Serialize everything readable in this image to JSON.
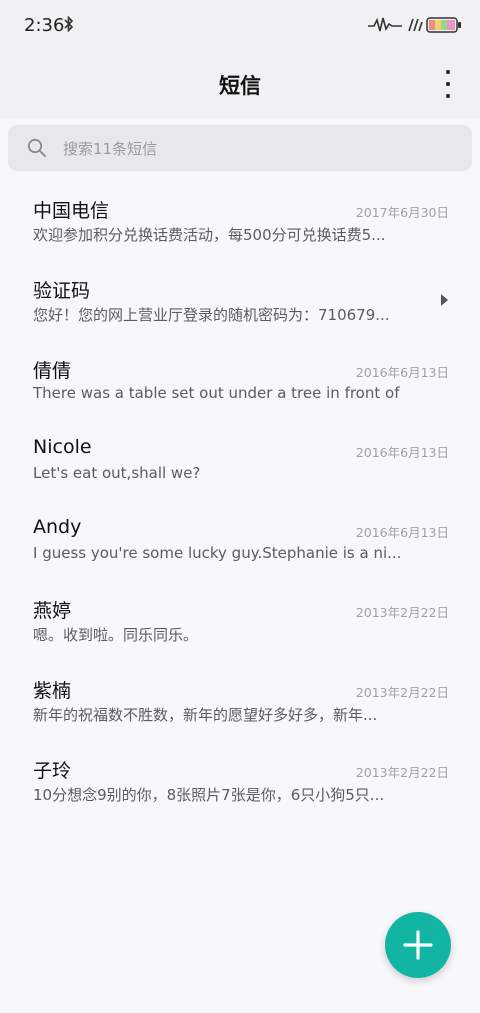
{
  "status_bar": {
    "time": "2:36",
    "icons": [
      "bluetooth-icon",
      "signal-icon",
      "wifi-icon",
      "battery-icon"
    ]
  },
  "header": {
    "title": "短信",
    "menu_icon": "more-vertical-icon"
  },
  "search": {
    "placeholder": "搜索11条短信",
    "icon": "search-icon"
  },
  "messages": [
    {
      "name": "中国电信",
      "date": "2017年6月30日",
      "preview": "欢迎参加积分兑换话费活动，每500分可兑换话费5..."
    },
    {
      "name": "验证码",
      "date": "",
      "preview": "您好！您的网上营业厅登录的随机密码为：710679...",
      "icon": "expand-arrow-icon"
    },
    {
      "name": "倩倩",
      "date": "2016年6月13日",
      "preview": "There was a table set out under a tree in front of ..."
    },
    {
      "name": "Nicole",
      "date": "2016年6月13日",
      "preview": "Let's eat out,shall we?"
    },
    {
      "name": "Andy",
      "date": "2016年6月13日",
      "preview": "I guess you're some lucky guy.Stephanie is a ni..."
    },
    {
      "name": "燕婷",
      "date": "2013年2月22日",
      "preview": "嗯。收到啦。同乐同乐。"
    },
    {
      "name": "紫楠",
      "date": "2013年2月22日",
      "preview": "新年的祝福数不胜数，新年的愿望好多好多，新年..."
    },
    {
      "name": "子玲",
      "date": "2013年2月22日",
      "preview": "10分想念9别的你，8张照片7张是你，6只小狗5只..."
    }
  ],
  "fab": {
    "icon": "plus-icon"
  },
  "colors": {
    "accent": "#12b5a3",
    "background": "#f8f8fb",
    "header_background": "#f1f1f4",
    "search_background": "#e8e8ec"
  }
}
